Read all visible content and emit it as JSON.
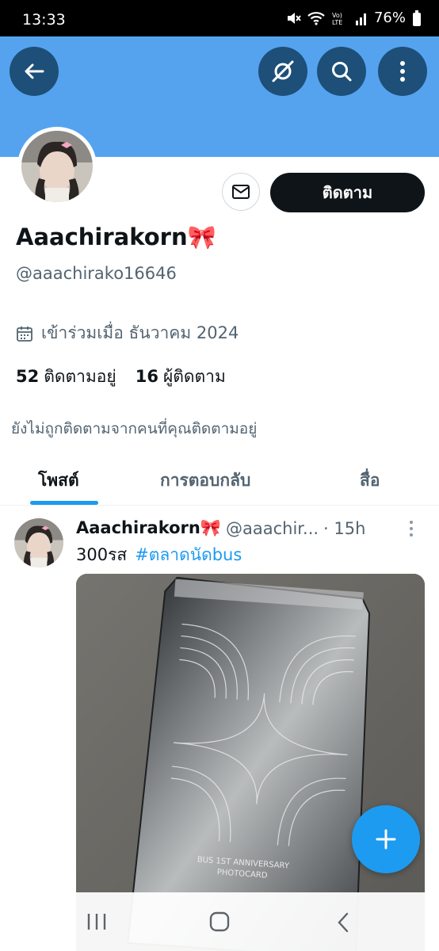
{
  "status_bar": {
    "time": "13:33",
    "battery": "76%",
    "icons": [
      "mute-icon",
      "wifi-icon",
      "volte-icon",
      "signal-icon",
      "battery-icon"
    ]
  },
  "colors": {
    "banner": "#55a3ef",
    "accent": "#1d9bf0",
    "follow_button": "#0f1419",
    "secondary_text": "#536471"
  },
  "header": {
    "icons": [
      "back-arrow-icon",
      "grok-icon",
      "search-icon",
      "more-vertical-icon"
    ]
  },
  "profile": {
    "display_name": "Aaachirakorn🎀",
    "handle": "@aaachirako16646",
    "joined": "เข้าร่วมเมื่อ ธันวาคม 2024",
    "following_count": "52",
    "following_label": "ติดตามอยู่",
    "followers_count": "16",
    "followers_label": "ผู้ติดตาม",
    "not_followed_note": "ยังไม่ถูกติดตามจากคนที่คุณติดตามอยู่",
    "follow_button_label": "ติดตาม"
  },
  "tabs": [
    {
      "label": "โพสต์",
      "active": true
    },
    {
      "label": "การตอบกลับ",
      "active": false
    },
    {
      "label": "สื่อ",
      "active": false
    }
  ],
  "post": {
    "display_name": "Aaachirakorn🎀",
    "handle": "@aaachir...",
    "time": "· 15h",
    "text": "300รส",
    "hashtag": "#ตลาดนัดbus",
    "image_caption_line1": "BUS 1ST ANNIVERSARY",
    "image_caption_line2": "PHOTOCARD"
  },
  "fab": {
    "icon": "plus-icon"
  },
  "nav_bar": {
    "icons": [
      "recent-apps-icon",
      "home-icon",
      "back-icon"
    ]
  }
}
